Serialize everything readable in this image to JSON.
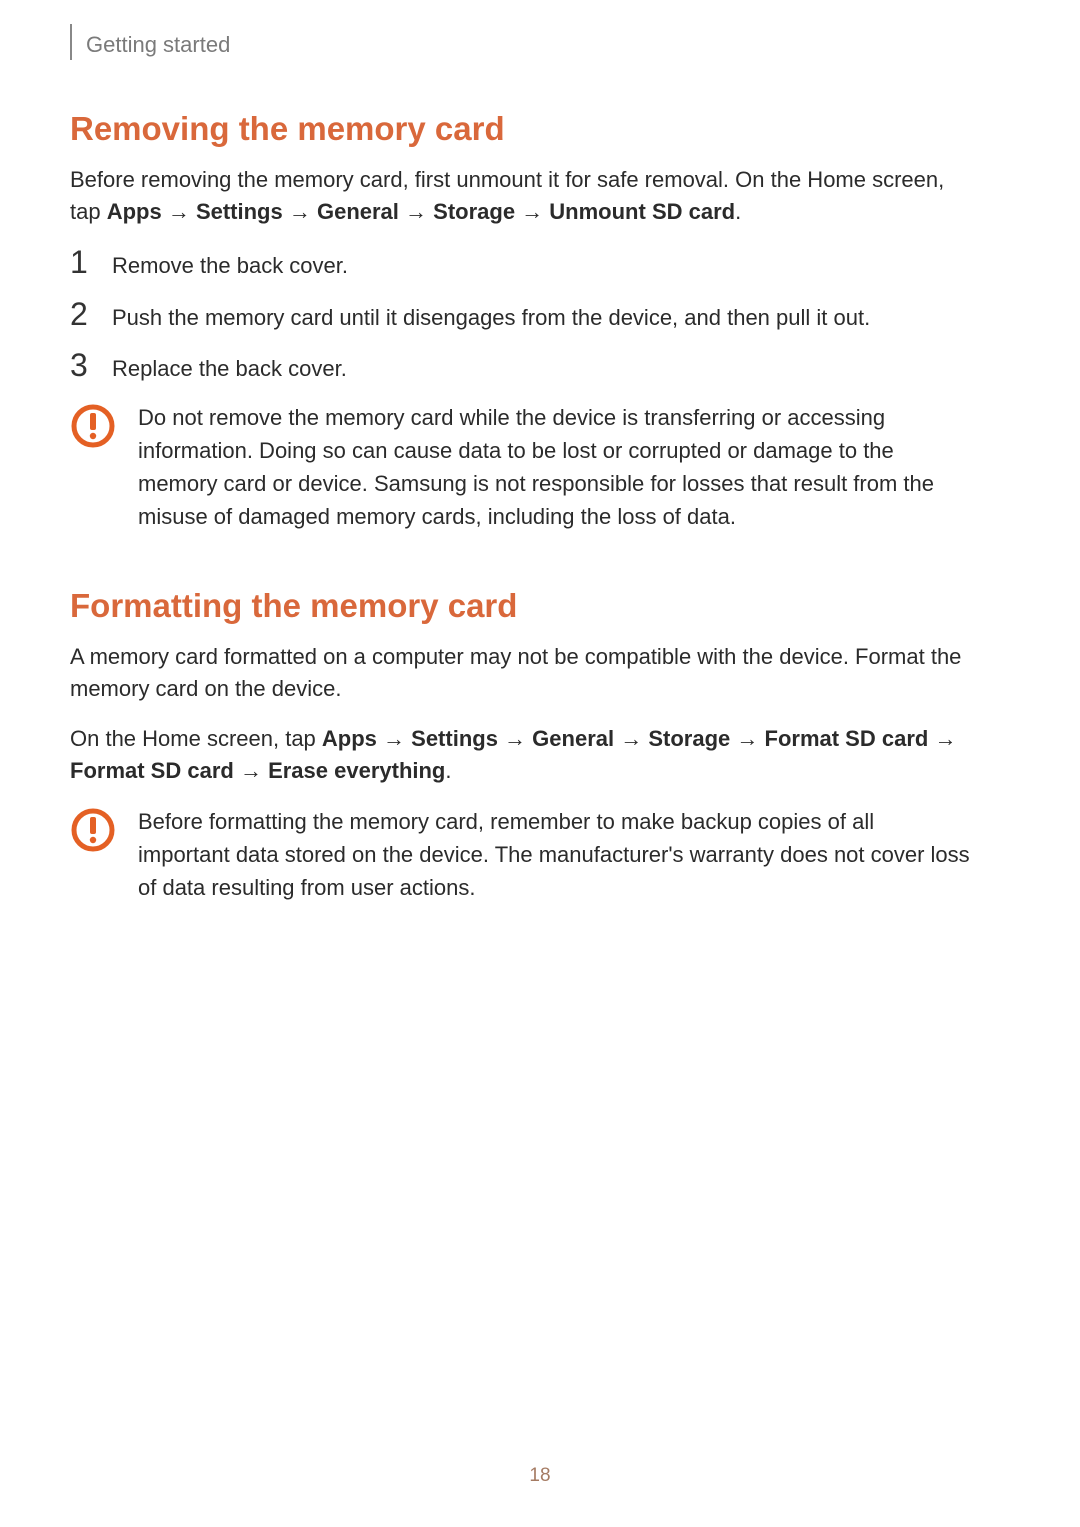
{
  "header": {
    "section": "Getting started"
  },
  "section1": {
    "title": "Removing the memory card",
    "intro_plain": "Before removing the memory card, first unmount it for safe removal. On the Home screen, tap ",
    "intro_bold_parts": [
      "Apps",
      "Settings",
      "General",
      "Storage",
      "Unmount SD card"
    ],
    "steps": [
      "Remove the back cover.",
      "Push the memory card until it disengages from the device, and then pull it out.",
      "Replace the back cover."
    ],
    "warning": "Do not remove the memory card while the device is transferring or accessing information. Doing so can cause data to be lost or corrupted or damage to the memory card or device. Samsung is not responsible for losses that result from the misuse of damaged memory cards, including the loss of data."
  },
  "section2": {
    "title": "Formatting the memory card",
    "para1": "A memory card formatted on a computer may not be compatible with the device. Format the memory card on the device.",
    "para2_plain": "On the Home screen, tap ",
    "para2_bold_parts": [
      "Apps",
      "Settings",
      "General",
      "Storage",
      "Format SD card",
      "Format SD card",
      "Erase everything"
    ],
    "warning": "Before formatting the memory card, remember to make backup copies of all important data stored on the device. The manufacturer's warranty does not cover loss of data resulting from user actions."
  },
  "arrow": " → ",
  "page_number": "18",
  "colors": {
    "accent": "#d9683b",
    "warn": "#e46024"
  }
}
